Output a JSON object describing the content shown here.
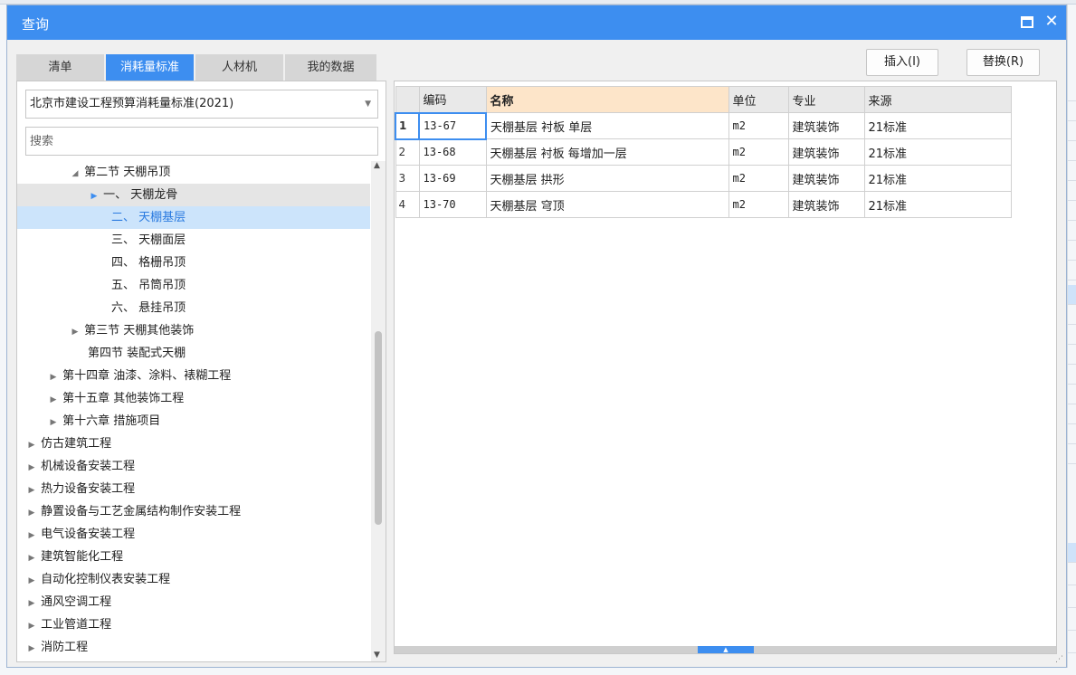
{
  "dialog": {
    "title": "查询",
    "close_symbol": "✕"
  },
  "tabs": [
    {
      "label": "清单",
      "active": false
    },
    {
      "label": "消耗量标准",
      "active": true
    },
    {
      "label": "人材机",
      "active": false
    },
    {
      "label": "我的数据",
      "active": false
    }
  ],
  "buttons": {
    "insert": "插入(I)",
    "replace": "替换(R)"
  },
  "left": {
    "standard_selected": "北京市建设工程预算消耗量标准(2021)",
    "search_placeholder": "搜索",
    "tree": [
      {
        "label": "第二节 天棚吊顶",
        "toggle": "expanded"
      },
      {
        "label": "一、 天棚龙骨",
        "toggle": "collapsed"
      },
      {
        "label": "二、 天棚基层",
        "toggle": "none",
        "selected": true
      },
      {
        "label": "三、 天棚面层",
        "toggle": "none"
      },
      {
        "label": "四、 格栅吊顶",
        "toggle": "none"
      },
      {
        "label": "五、 吊筒吊顶",
        "toggle": "none"
      },
      {
        "label": "六、 悬挂吊顶",
        "toggle": "none"
      },
      {
        "label": "第三节 天棚其他装饰",
        "toggle": "collapsed"
      },
      {
        "label": "第四节 装配式天棚",
        "toggle": "none"
      },
      {
        "label": "第十四章 油漆、涂料、裱糊工程",
        "toggle": "collapsed"
      },
      {
        "label": "第十五章 其他装饰工程",
        "toggle": "collapsed"
      },
      {
        "label": "第十六章 措施项目",
        "toggle": "collapsed"
      },
      {
        "label": "仿古建筑工程",
        "toggle": "collapsed"
      },
      {
        "label": "机械设备安装工程",
        "toggle": "collapsed"
      },
      {
        "label": "热力设备安装工程",
        "toggle": "collapsed"
      },
      {
        "label": "静置设备与工艺金属结构制作安装工程",
        "toggle": "collapsed"
      },
      {
        "label": "电气设备安装工程",
        "toggle": "collapsed"
      },
      {
        "label": "建筑智能化工程",
        "toggle": "collapsed"
      },
      {
        "label": "自动化控制仪表安装工程",
        "toggle": "collapsed"
      },
      {
        "label": "通风空调工程",
        "toggle": "collapsed"
      },
      {
        "label": "工业管道工程",
        "toggle": "collapsed"
      },
      {
        "label": "消防工程",
        "toggle": "collapsed"
      }
    ]
  },
  "grid": {
    "columns": [
      "编码",
      "名称",
      "单位",
      "专业",
      "来源"
    ],
    "rows": [
      {
        "num": "1",
        "code": "13-67",
        "name": "天棚基层 衬板 单层",
        "unit": "m2",
        "major": "建筑装饰",
        "source": "21标准"
      },
      {
        "num": "2",
        "code": "13-68",
        "name": "天棚基层 衬板 每增加一层",
        "unit": "m2",
        "major": "建筑装饰",
        "source": "21标准"
      },
      {
        "num": "3",
        "code": "13-69",
        "name": "天棚基层 拱形",
        "unit": "m2",
        "major": "建筑装饰",
        "source": "21标准"
      },
      {
        "num": "4",
        "code": "13-70",
        "name": "天棚基层 穹顶",
        "unit": "m2",
        "major": "建筑装饰",
        "source": "21标准"
      }
    ]
  },
  "colors": {
    "accent": "#3d8ef0",
    "selected_row": "#cce4fb",
    "header_highlight": "#fde5c9"
  }
}
